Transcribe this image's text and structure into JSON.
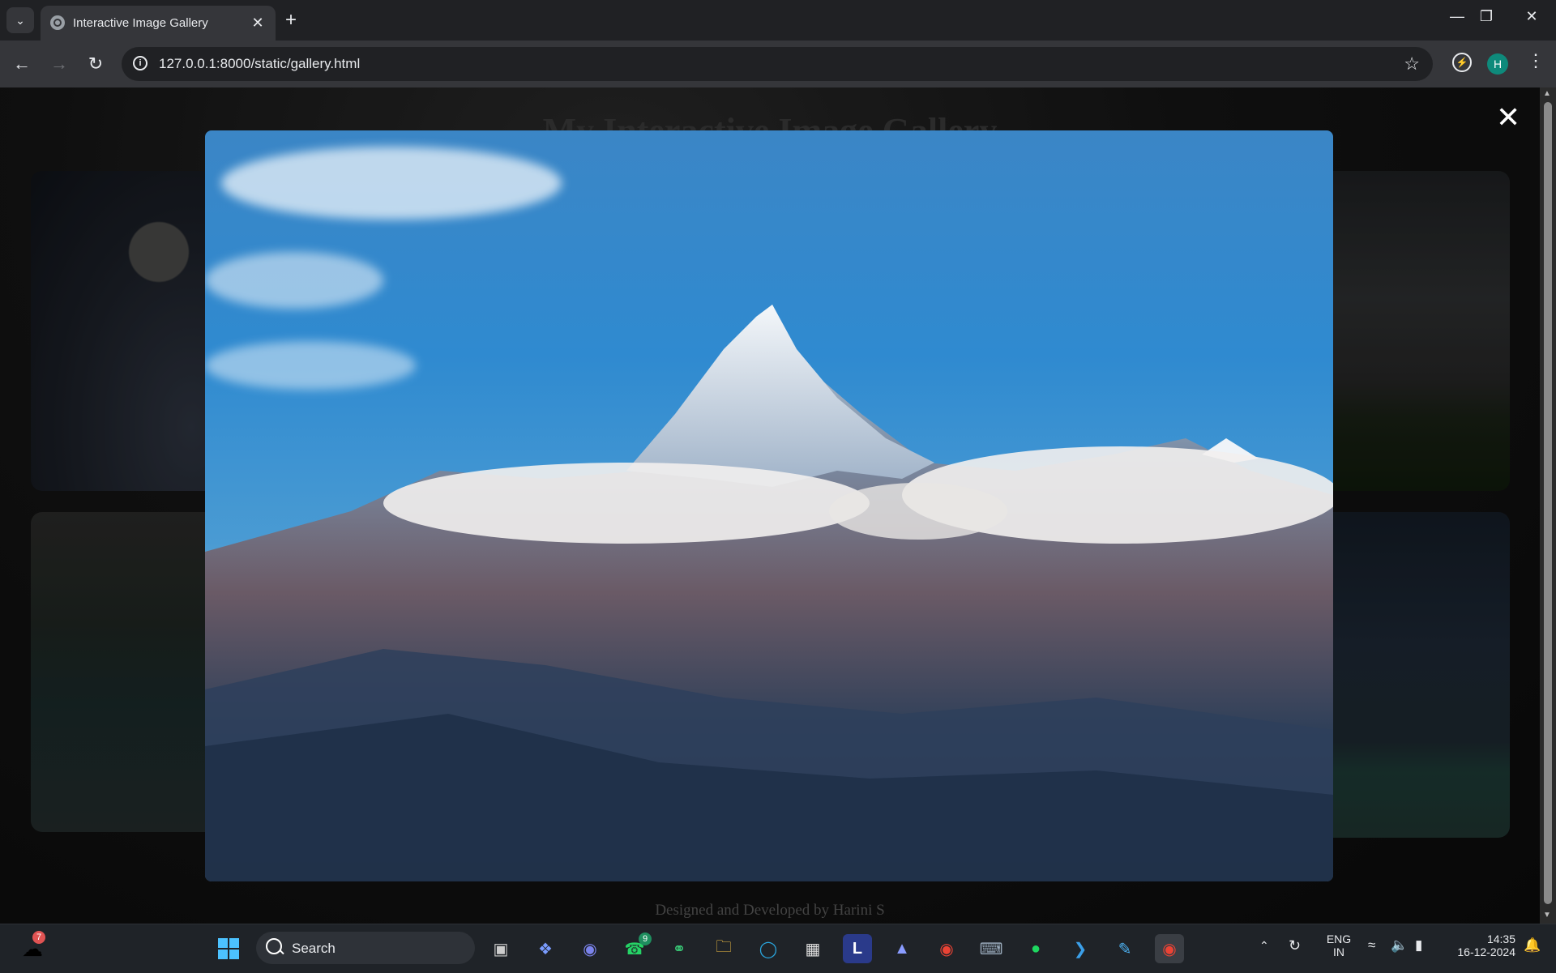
{
  "browser": {
    "tab_title": "Interactive Image Gallery",
    "url": "127.0.0.1:8000/static/gallery.html",
    "profile_initial": "H"
  },
  "page": {
    "title": "My Interactive Image Gallery",
    "footer": "Designed and Developed by Harini S"
  },
  "lightbox": {
    "image_alt": "Snow-capped mountain peak above clouds"
  },
  "taskbar": {
    "search_label": "Search",
    "weather_badge": "7",
    "whatsapp_badge": "9",
    "language": "ENG",
    "region": "IN",
    "time": "14:35",
    "date": "16-12-2024"
  },
  "colors": {
    "chrome_bg": "#202124",
    "toolbar_bg": "#35363a",
    "sky_blue": "#2f8ad0",
    "profile_green": "#0e8a7b"
  }
}
